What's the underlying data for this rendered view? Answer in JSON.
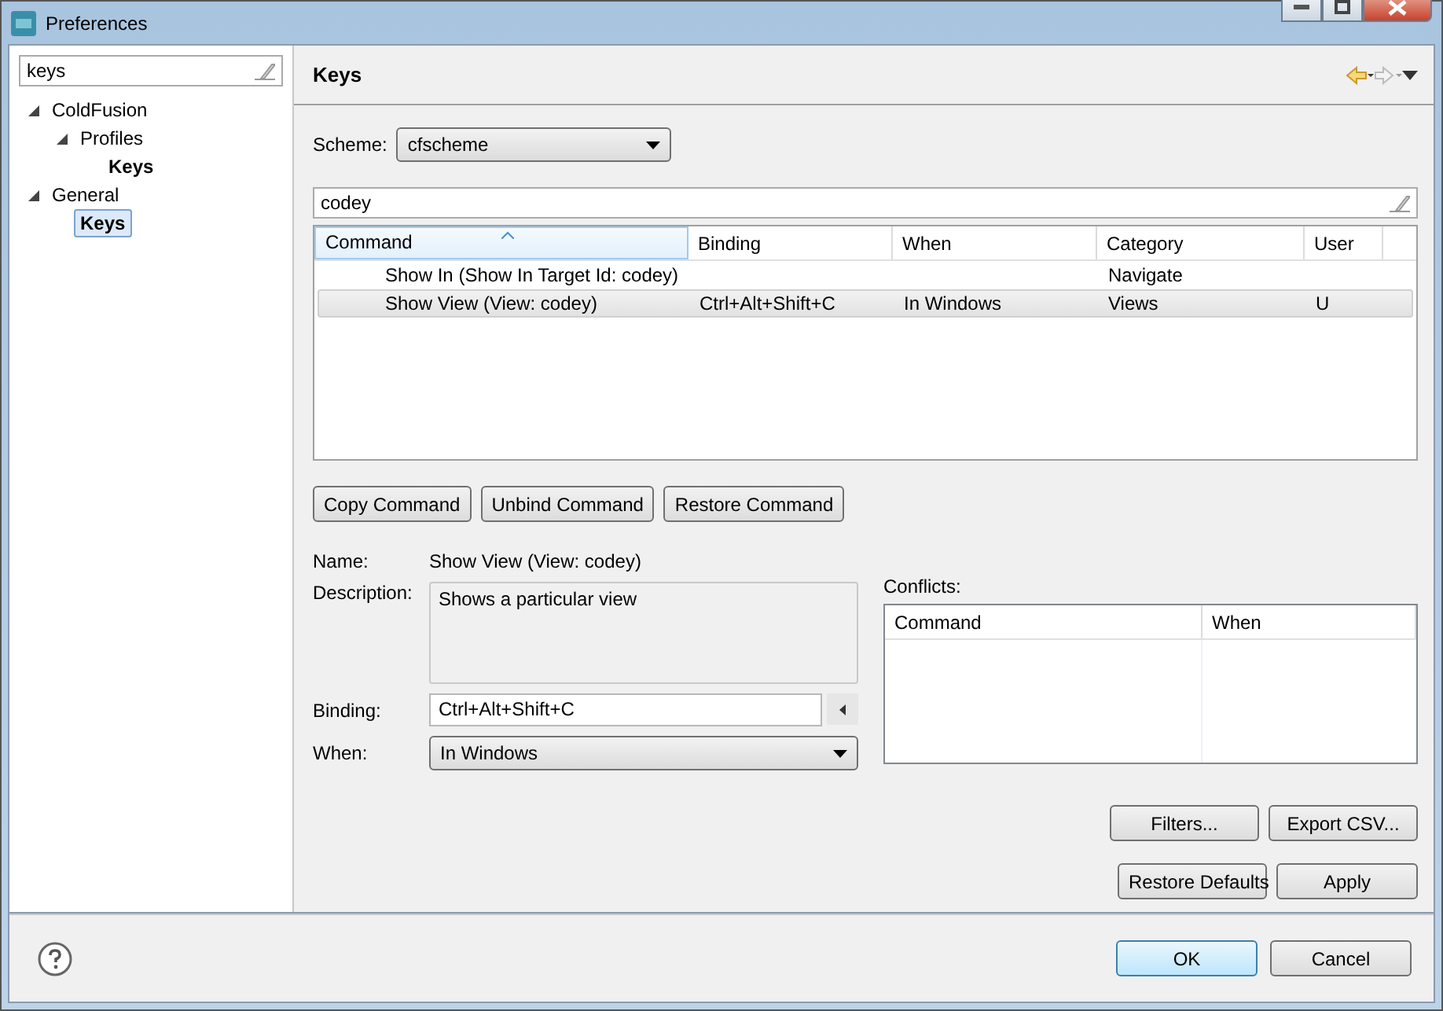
{
  "window": {
    "title": "Preferences"
  },
  "filter": {
    "value": "keys"
  },
  "tree": [
    {
      "label": "ColdFusion",
      "expanded": true,
      "selected": false,
      "children": [
        {
          "label": "Profiles",
          "expanded": true,
          "selected": false,
          "children": [
            {
              "label": "Keys",
              "selected": false
            }
          ]
        }
      ]
    },
    {
      "label": "General",
      "expanded": true,
      "selected": false,
      "children": [
        {
          "label": "Keys",
          "selected": true
        }
      ]
    }
  ],
  "page": {
    "title": "Keys"
  },
  "scheme": {
    "label": "Scheme:",
    "value": "cfscheme"
  },
  "search": {
    "value": "codey"
  },
  "table": {
    "columns": [
      {
        "label": "Command",
        "sorted": true
      },
      {
        "label": "Binding",
        "sorted": false
      },
      {
        "label": "When",
        "sorted": false
      },
      {
        "label": "Category",
        "sorted": false
      },
      {
        "label": "User",
        "sorted": false
      }
    ],
    "rows": [
      {
        "selected": false,
        "cells": [
          "Show In (Show In Target Id: codey)",
          "",
          "",
          "Navigate",
          ""
        ]
      },
      {
        "selected": true,
        "cells": [
          "Show View (View: codey)",
          "Ctrl+Alt+Shift+C",
          "In Windows",
          "Views",
          "U"
        ]
      }
    ]
  },
  "command_buttons": [
    "Copy Command",
    "Unbind Command",
    "Restore Command"
  ],
  "details": {
    "name_label": "Name:",
    "name": "Show View (View: codey)",
    "description_label": "Description:",
    "description": "Shows a particular view",
    "binding_label": "Binding:",
    "binding": "Ctrl+Alt+Shift+C",
    "when_label": "When:",
    "when": "In Windows"
  },
  "conflicts": {
    "label": "Conflicts:",
    "columns": [
      "Command",
      "When"
    ]
  },
  "side_buttons": [
    "Filters...",
    "Export CSV..."
  ],
  "page_buttons": [
    "Restore Defaults",
    "Apply"
  ],
  "dialog_buttons": [
    {
      "label": "OK",
      "default": true
    },
    {
      "label": "Cancel",
      "default": false
    }
  ]
}
